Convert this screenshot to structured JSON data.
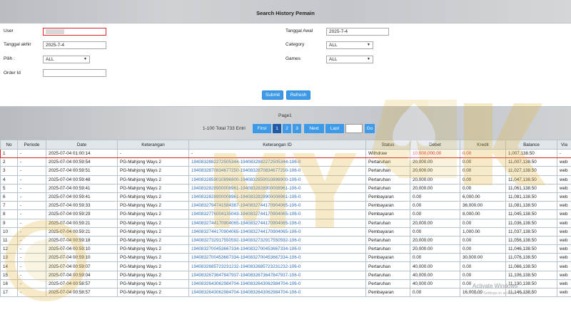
{
  "page": {
    "title": "Search History Pemain"
  },
  "form": {
    "user_label": "User",
    "user_value": "",
    "tanggal_awal_label": "Tanggal Awal",
    "tanggal_awal_value": "2025-7-4",
    "tanggal_akhir_label": "Tanggal akhir",
    "tanggal_akhir_value": "2025-7-4",
    "category_label": "Category",
    "category_value": "ALL",
    "pilih_label": "Pilih  :",
    "pilih_value": "ALL",
    "games_label": "Games",
    "games_value": "ALL",
    "order_id_label": "Order Id",
    "order_id_value": "",
    "submit_label": "Submit",
    "refresh_label": "Refresh"
  },
  "pagination": {
    "page_label": "Page1",
    "total_label": "1-100 Total 733 Entri",
    "first_label": "First",
    "pages": [
      "1",
      "2",
      "3"
    ],
    "next_label": "Next",
    "last_label": "Last",
    "go_label": "Go"
  },
  "table": {
    "headers": [
      "No",
      "Periode",
      "Date",
      "Keterangan",
      "Keterangan ID",
      "Status",
      "Debet",
      "Kredit",
      "Balance",
      "Via"
    ],
    "rows": [
      [
        "1",
        "-",
        "2025-07-04 01:00:14",
        "-",
        "-",
        "Withdraw",
        "10,000,000.00",
        "0.00",
        "1,007,138.50",
        "-"
      ],
      [
        "2",
        "-",
        "2025-07-04 00:59:54",
        "PG-Mahjong Ways 2",
        "1940832882272505344-1940832882272505344-106-0",
        "Pertaruhan",
        "20,000.00",
        "0.00",
        "11,007,138.50",
        "web"
      ],
      [
        "3",
        "-",
        "2025-07-04 00:59:51",
        "PG-Mahjong Ways 2",
        "1940832870834677250-1940832870834677250-106-0",
        "Pertaruhan",
        "20,000.00",
        "0.00",
        "11,027,138.50",
        "web"
      ],
      [
        "4",
        "-",
        "2025-07-04 00:59:48",
        "PG-Mahjong Ways 2",
        "1940832859010896900-1940832859010896900-106-0",
        "Pertaruhan",
        "20,000.00",
        "0.00",
        "11,047,138.50",
        "web"
      ],
      [
        "5",
        "-",
        "2025-07-04 00:59:41",
        "PG-Mahjong Ways 2",
        "1940832828900008961-1940832828900008961-106-0",
        "Pertaruhan",
        "20,000.00",
        "0.00",
        "11,061,138.50",
        "web"
      ],
      [
        "6",
        "-",
        "2025-07-04 00:59:41",
        "PG-Mahjong Ways 2",
        "1940832828900008961-1940832828900008961-106-0",
        "Pembayaran",
        "0.00",
        "6,000.00",
        "11,081,138.50",
        "web"
      ],
      [
        "7",
        "-",
        "2025-07-04 00:59:33",
        "PG-Mahjong Ways 2",
        "1940832794741584387-1940832744170904065-106-0",
        "Pembayaran",
        "0.00",
        "36,000.00",
        "11,081,138.50",
        "web"
      ],
      [
        "8",
        "-",
        "2025-07-04 00:59:29",
        "PG-Mahjong Ways 2",
        "1940832776004135043-1940832744170904065-106-0",
        "Pembayaran",
        "0.00",
        "8,000.00",
        "11,045,138.50",
        "web"
      ],
      [
        "9",
        "-",
        "2025-07-04 00:59:21",
        "PG-Mahjong Ways 2",
        "1940832744170904065-1940832744170904065-106-0",
        "Pertaruhan",
        "20,000.00",
        "0.00",
        "11,036,138.50",
        "web"
      ],
      [
        "10",
        "-",
        "2025-07-04 00:59:21",
        "PG-Mahjong Ways 2",
        "1940832744170904065-1940832744170904065-106-0",
        "Pembayaran",
        "0.00",
        "1,000.00",
        "11,037,138.50",
        "web"
      ],
      [
        "11",
        "-",
        "2025-07-04 00:59:18",
        "PG-Mahjong Ways 2",
        "1940832732917550592-1940832732917550592-106-0",
        "Pertaruhan",
        "20,000.00",
        "0.00",
        "11,056,138.50",
        "web"
      ],
      [
        "12",
        "-",
        "2025-07-04 00:59:10",
        "PG-Mahjong Ways 2",
        "1940832700453667334-1940832700453667334-106-0",
        "Pertaruhan",
        "20,000.00",
        "0.00",
        "11,046,138.50",
        "web"
      ],
      [
        "13",
        "-",
        "2025-07-04 00:59:10",
        "PG-Mahjong Ways 2",
        "1940832700453667334-1940832700453667334-106-0",
        "Pembayaran",
        "0.00",
        "30,000.00",
        "11,076,138.50",
        "web"
      ],
      [
        "14",
        "-",
        "2025-07-04 00:59:07",
        "PG-Mahjong Ways 2",
        "1940832685723231232-1940832685723231232-106-0",
        "Pertaruhan",
        "40,000.00",
        "0.00",
        "11,066,138.50",
        "web"
      ],
      [
        "15",
        "-",
        "2025-07-04 00:59:04",
        "PG-Mahjong Ways 2",
        "1940832673647847937-1940832673647847937-106-0",
        "Pertaruhan",
        "40,000.00",
        "0.00",
        "11,106,138.50",
        "web"
      ],
      [
        "16",
        "-",
        "2025-07-04 00:58:57",
        "PG-Mahjong Ways 2",
        "1940832643062984704-1940832643062984704-106-0",
        "Pertaruhan",
        "40,000.00",
        "0.00",
        "11,130,138.50",
        "web"
      ],
      [
        "17",
        "-",
        "2025-07-04 00:58:57",
        "PG-Mahjong Ways 2",
        "1940832643062984704-1940832643062984704-106-0",
        "Pembayaran",
        "0.00",
        "16,000.00",
        "11,146,138.50",
        "web"
      ]
    ]
  },
  "watermark": {
    "brand_text": "MTY4UK"
  },
  "windows_notice": {
    "title": "Activate Windows",
    "subtitle": "Go to Settings to activate Windows"
  },
  "colors": {
    "accent": "#3d9ae8",
    "highlight": "#d9242b",
    "link": "#2f6fc4",
    "watermark": "#e0b53a"
  }
}
